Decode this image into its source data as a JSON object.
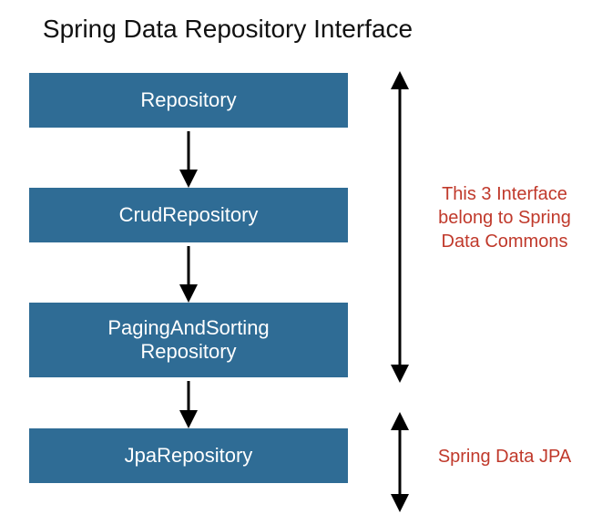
{
  "title": "Spring Data Repository Interface",
  "boxes": {
    "repo": "Repository",
    "crud": "CrudRepository",
    "paging_line1": "PagingAndSorting",
    "paging_line2": "Repository",
    "jpa": "JpaRepository"
  },
  "annotations": {
    "commons_line1": "This 3 Interface",
    "commons_line2": "belong to Spring",
    "commons_line3": "Data Commons",
    "jpa": "Spring Data JPA"
  },
  "colors": {
    "box_bg": "#2f6c95",
    "box_text": "#ffffff",
    "annotation_text": "#c0392b"
  }
}
